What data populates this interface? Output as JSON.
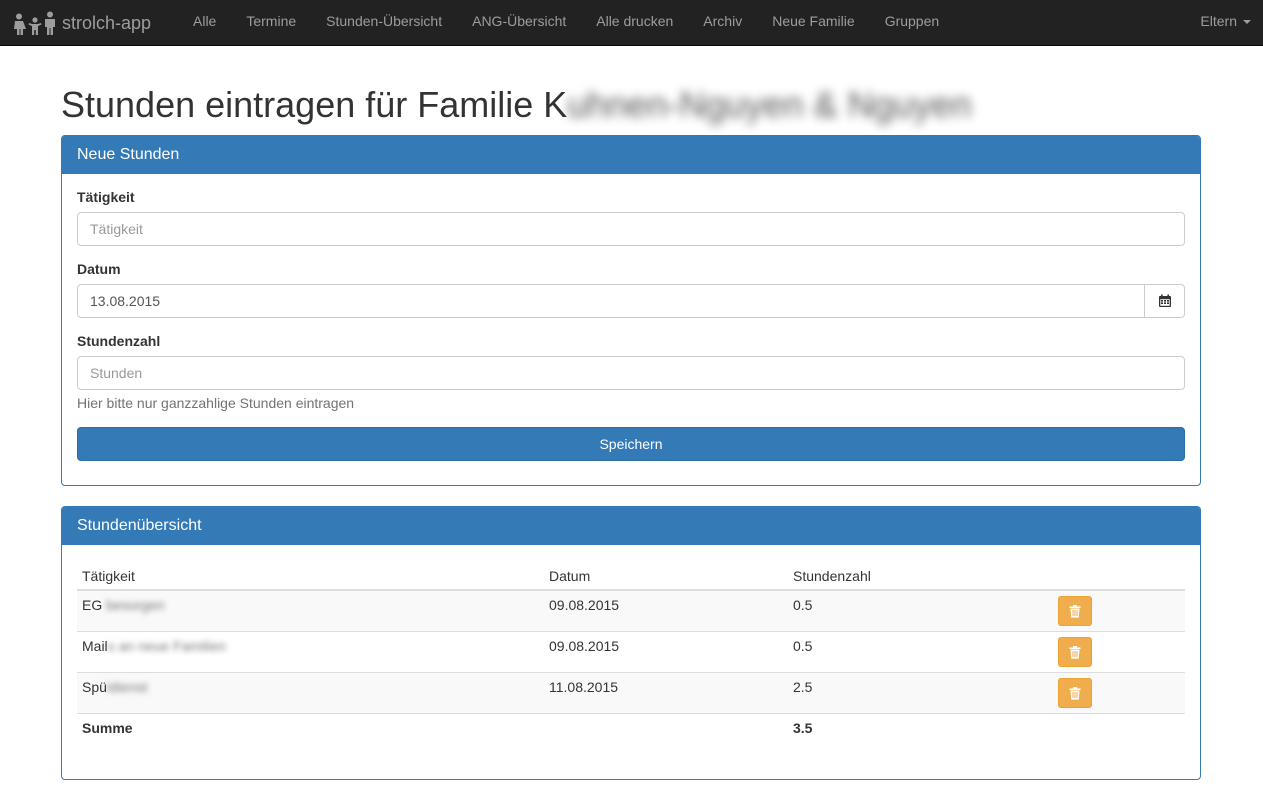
{
  "navbar": {
    "brand": "strolch-app",
    "items": [
      "Alle",
      "Termine",
      "Stunden-Übersicht",
      "ANG-Übersicht",
      "Alle drucken",
      "Archiv",
      "Neue Familie",
      "Gruppen"
    ],
    "right_menu": "Eltern"
  },
  "page": {
    "title_prefix": "Stunden eintragen für Familie K",
    "title_redacted": "uhnen-Nguyen & Nguyen"
  },
  "form_panel": {
    "heading": "Neue Stunden",
    "activity": {
      "label": "Tätigkeit",
      "placeholder": "Tätigkeit",
      "value": ""
    },
    "date": {
      "label": "Datum",
      "value": "13.08.2015"
    },
    "hours": {
      "label": "Stundenzahl",
      "placeholder": "Stunden",
      "help": "Hier bitte nur ganzzahlige Stunden eintragen"
    },
    "submit_label": "Speichern"
  },
  "overview_panel": {
    "heading": "Stundenübersicht",
    "columns": [
      "Tätigkeit",
      "Datum",
      "Stundenzahl"
    ],
    "rows": [
      {
        "activity_visible": "EG",
        "activity_redacted": "besorgen",
        "date": "09.08.2015",
        "hours": "0.5"
      },
      {
        "activity_visible": "Mail",
        "activity_redacted": "s an neue Familien",
        "date": "09.08.2015",
        "hours": "0.5"
      },
      {
        "activity_visible": "Spü",
        "activity_redacted": "ldienst",
        "date": "11.08.2015",
        "hours": "2.5"
      }
    ],
    "sum_label": "Summe",
    "sum_value": "3.5"
  },
  "colors": {
    "navbar": "#222222",
    "primary": "#337ab7",
    "warning": "#f0ad4e"
  },
  "icons": {
    "brand": "family-icon",
    "calendar": "calendar-icon",
    "delete": "trash-icon"
  }
}
